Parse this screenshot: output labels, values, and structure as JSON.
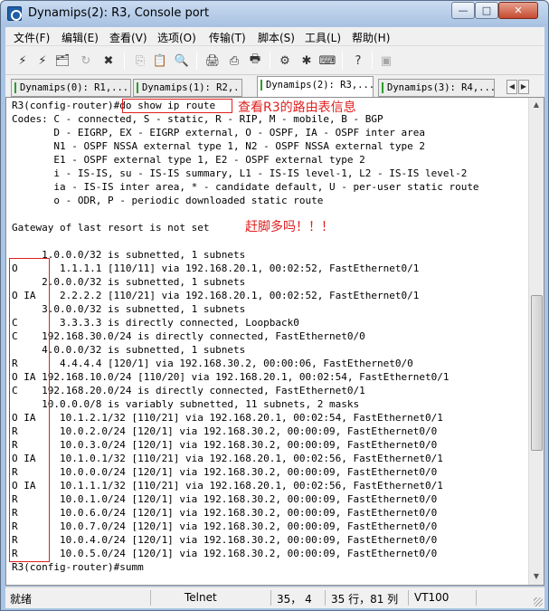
{
  "window": {
    "title": "Dynamips(2): R3, Console port",
    "controls": {
      "minimize": "—",
      "maximize": "□",
      "close": "✕"
    }
  },
  "menu": [
    "文件(F)",
    "编辑(E)",
    "查看(V)",
    "选项(O)",
    "传输(T)",
    "脚本(S)",
    "工具(L)",
    "帮助(H)"
  ],
  "toolbar": {
    "icons": [
      "connect-icon",
      "quick-connect-icon",
      "connect-tab-icon",
      "reconnect-icon",
      "disconnect-icon",
      "copy-icon",
      "paste-icon",
      "find-icon",
      "print-icon",
      "print-setup-icon",
      "print-screen-icon",
      "session-options-icon",
      "global-options-icon",
      "keymap-icon",
      "help-icon",
      "sftp-icon"
    ],
    "glyphs": [
      "⚡",
      "⚡",
      "🗂",
      "↻",
      "✖",
      "⎘",
      "📋",
      "🔍",
      "🖨",
      "⎙",
      "🖶",
      "⚙",
      "✱",
      "⌨",
      "?",
      "▣"
    ]
  },
  "tabs": [
    {
      "label": "Dynamips(0): R1,...",
      "active": false
    },
    {
      "label": "Dynamips(1): R2,...",
      "active": false
    },
    {
      "label": "Dynamips(2): R3,...",
      "active": true
    },
    {
      "label": "Dynamips(3): R4,...",
      "active": false
    }
  ],
  "tab_nav": {
    "prev": "◀",
    "next": "▶"
  },
  "console": {
    "lines": [
      "R3(config-router)#do show ip route",
      "Codes: C - connected, S - static, R - RIP, M - mobile, B - BGP",
      "       D - EIGRP, EX - EIGRP external, O - OSPF, IA - OSPF inter area",
      "       N1 - OSPF NSSA external type 1, N2 - OSPF NSSA external type 2",
      "       E1 - OSPF external type 1, E2 - OSPF external type 2",
      "       i - IS-IS, su - IS-IS summary, L1 - IS-IS level-1, L2 - IS-IS level-2",
      "       ia - IS-IS inter area, * - candidate default, U - per-user static route",
      "       o - ODR, P - periodic downloaded static route",
      "",
      "Gateway of last resort is not set",
      "",
      "     1.0.0.0/32 is subnetted, 1 subnets",
      "O       1.1.1.1 [110/11] via 192.168.20.1, 00:02:52, FastEthernet0/1",
      "     2.0.0.0/32 is subnetted, 1 subnets",
      "O IA    2.2.2.2 [110/21] via 192.168.20.1, 00:02:52, FastEthernet0/1",
      "     3.0.0.0/32 is subnetted, 1 subnets",
      "C       3.3.3.3 is directly connected, Loopback0",
      "C    192.168.30.0/24 is directly connected, FastEthernet0/0",
      "     4.0.0.0/32 is subnetted, 1 subnets",
      "R       4.4.4.4 [120/1] via 192.168.30.2, 00:00:06, FastEthernet0/0",
      "O IA 192.168.10.0/24 [110/20] via 192.168.20.1, 00:02:54, FastEthernet0/1",
      "C    192.168.20.0/24 is directly connected, FastEthernet0/1",
      "     10.0.0.0/8 is variably subnetted, 11 subnets, 2 masks",
      "O IA    10.1.2.1/32 [110/21] via 192.168.20.1, 00:02:54, FastEthernet0/1",
      "R       10.0.2.0/24 [120/1] via 192.168.30.2, 00:00:09, FastEthernet0/0",
      "R       10.0.3.0/24 [120/1] via 192.168.30.2, 00:00:09, FastEthernet0/0",
      "O IA    10.1.0.1/32 [110/21] via 192.168.20.1, 00:02:56, FastEthernet0/1",
      "R       10.0.0.0/24 [120/1] via 192.168.30.2, 00:00:09, FastEthernet0/0",
      "O IA    10.1.1.1/32 [110/21] via 192.168.20.1, 00:02:56, FastEthernet0/1",
      "R       10.0.1.0/24 [120/1] via 192.168.30.2, 00:00:09, FastEthernet0/0",
      "R       10.0.6.0/24 [120/1] via 192.168.30.2, 00:00:09, FastEthernet0/0",
      "R       10.0.7.0/24 [120/1] via 192.168.30.2, 00:00:09, FastEthernet0/0",
      "R       10.0.4.0/24 [120/1] via 192.168.30.2, 00:00:09, FastEthernet0/0",
      "R       10.0.5.0/24 [120/1] via 192.168.30.2, 00:00:09, FastEthernet0/0",
      "R3(config-router)#summ"
    ]
  },
  "annotations": {
    "route_table_note": "查看R3的路由表信息",
    "exclaim_note": "赶脚多吗！！！",
    "color": "#e02020"
  },
  "scrollbar": {
    "up": "▲",
    "down": "▼"
  },
  "status": {
    "ready": "就绪",
    "protocol": "Telnet",
    "cursor": "35， 4",
    "size": "35 行，81 列",
    "emulation": "VT100"
  }
}
